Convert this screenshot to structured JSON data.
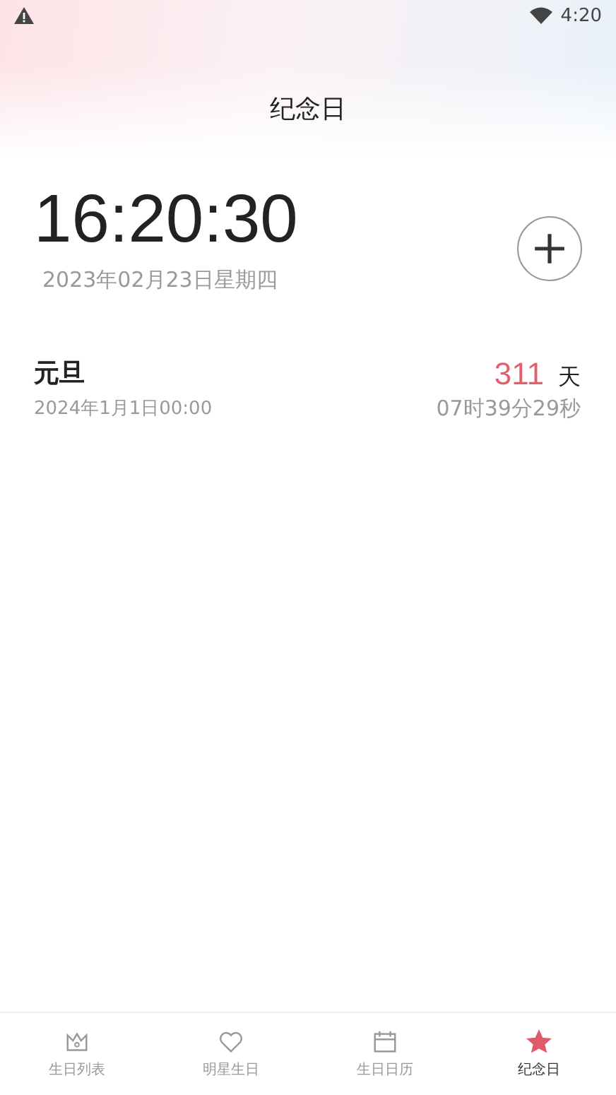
{
  "status_bar": {
    "time": "4:20"
  },
  "header": {
    "title": "纪念日"
  },
  "clock": {
    "time": "16:20:30",
    "date": "2023年02月23日星期四"
  },
  "events": [
    {
      "name": "元旦",
      "date": "2024年1月1日00:00",
      "days": "311",
      "days_unit": "天",
      "remaining": "07时39分29秒"
    }
  ],
  "tabs": [
    {
      "kind": "crown",
      "label": "生日列表",
      "selected": false
    },
    {
      "kind": "heart",
      "label": "明星生日",
      "selected": false
    },
    {
      "kind": "calendar",
      "label": "生日日历",
      "selected": false
    },
    {
      "kind": "star",
      "label": "纪念日",
      "selected": true
    }
  ]
}
